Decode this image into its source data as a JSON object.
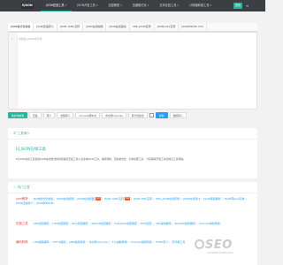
{
  "brand": {
    "logo": "EJSON"
  },
  "nav": [
    {
      "label": "JSON在线工具",
      "caret": "▾"
    },
    {
      "label": "JSON开发工具",
      "caret": "▾"
    },
    {
      "label": "加密解密",
      "caret": "▾"
    },
    {
      "label": "压缩格式化",
      "caret": "▾"
    },
    {
      "label": "文本在线工具",
      "caret": "▾"
    },
    {
      "label": "计算器转换工具",
      "caret": "▾"
    }
  ],
  "login": "登录",
  "tabs": [
    "JSON格式化校验",
    "JSON压缩转义",
    "JSON YAML互转",
    "JSON在线编辑",
    "JSON在线美化",
    "XML-JSON互转",
    "JSON-CSV互转",
    "JSON/EXCEL CSV"
  ],
  "editor": {
    "line": "1",
    "placeholder": "请粘贴入JSON字符串"
  },
  "toolbar": [
    "格式化校验",
    "压缩",
    "转义",
    "去除转义",
    "Unicode转中文",
    "中文转Unicode",
    "转为无格式",
    "保留转义"
  ],
  "toolbar_copy": "复制",
  "intro": {
    "heading": "工具简介",
    "title": "EJ JSON在线工具",
    "text": "EJ JSON在线工具提供JSON在线格式校验和美化压缩工具以及多种JSON工具，编码转换、压缩格式化、文本处理工具、计算器等开发工具的综合工具网站。"
  },
  "hot": {
    "heading": "热门工具",
    "rows": [
      {
        "cat": "json解析",
        "links": [
          "JSON格式化校验",
          "JSON在线编辑",
          "JSON在线视图",
          "JSON YAML互转",
          "JSON XML互转",
          "XML_JSON在线转换",
          "JSON在线对比",
          "JSON逐层解析",
          "JSON转Java实体",
          "JSON压缩转义",
          "JSON转EXCEL"
        ]
      },
      {
        "cat": "压缩工具",
        "links": [
          "AES加密解密",
          "DES加密解密",
          "RC4加密解密",
          "Rabbit加密解密",
          "TripleDes加密解密",
          "MD5加密",
          "URL编码解码",
          "Base64编码解码",
          "Unicode编码转换"
        ]
      },
      {
        "cat": "编码转换",
        "links": [
          "URL编码解码",
          "UTF-8编码",
          "GBK编码转换",
          "中文转Unicode",
          "十六进制转换",
          "Unicode编码转换",
          "HTML转义",
          "字符串工具"
        ]
      }
    ]
  },
  "watermark": {
    "text": "SEO",
    "sub": "GUANGZHOUSEO.COM"
  },
  "colors": {
    "accent": "#1cbb9b",
    "topbar": "#3b3f44",
    "link": "#1e9fff",
    "category": "#e84b3a",
    "hot_badge": "#ff5722"
  }
}
